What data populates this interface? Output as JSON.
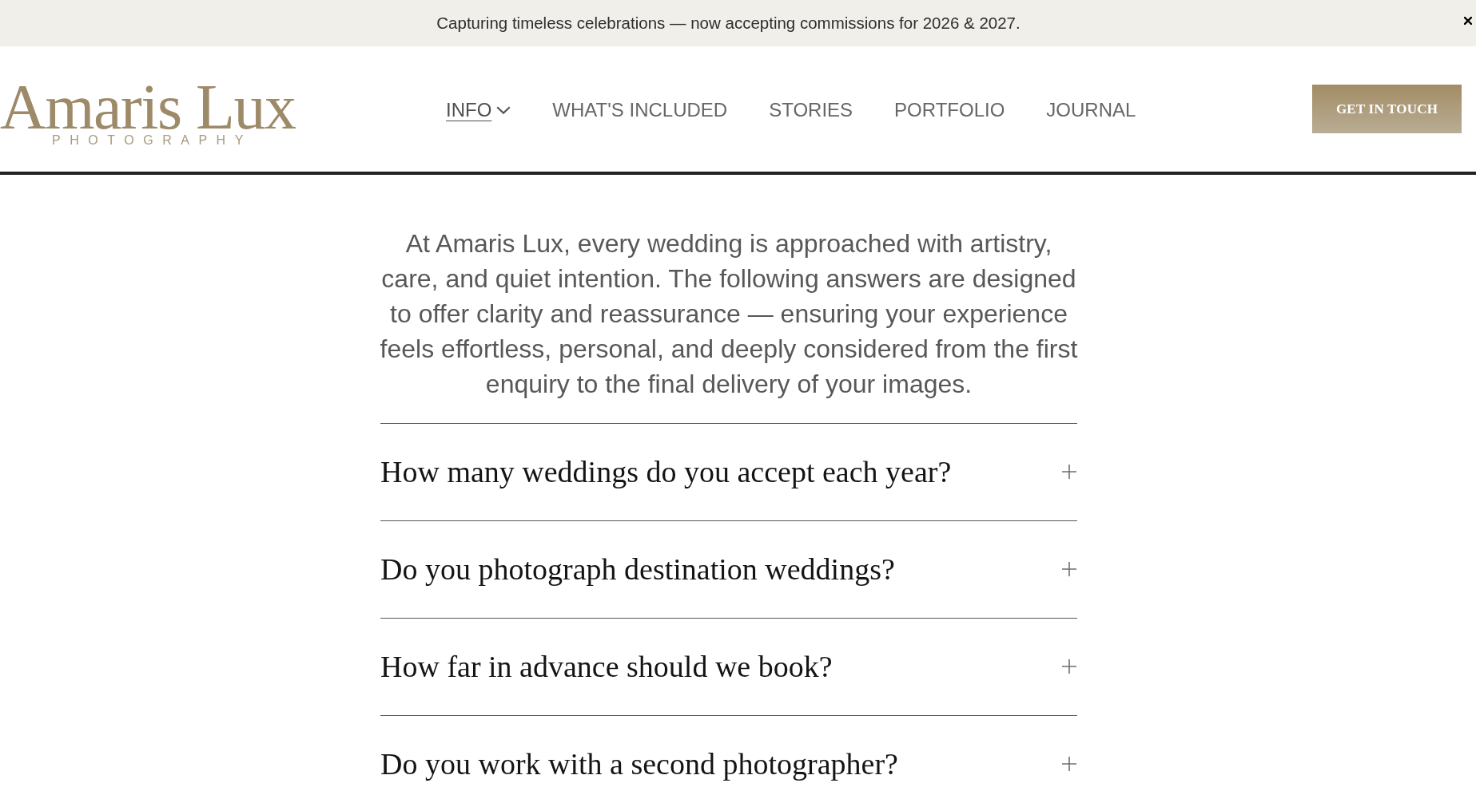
{
  "announcement": {
    "text": "Capturing timeless celebrations — now accepting commissions for 2026 & 2027."
  },
  "header": {
    "logo": {
      "name": "Amaris Lux",
      "tagline": "PHOTOGRAPHY"
    },
    "nav": [
      {
        "label": "INFO",
        "selected": true,
        "dropdown": true
      },
      {
        "label": "WHAT'S INCLUDED",
        "selected": false,
        "dropdown": false
      },
      {
        "label": "STORIES",
        "selected": false,
        "dropdown": false
      },
      {
        "label": "PORTFOLIO",
        "selected": false,
        "dropdown": false
      },
      {
        "label": "JOURNAL",
        "selected": false,
        "dropdown": false
      }
    ],
    "cta": "GET IN TOUCH"
  },
  "intro": "At Amaris Lux, every wedding is approached with artistry, care, and quiet intention. The following answers are designed to offer clarity and reassurance — ensuring your experience feels effortless, personal, and deeply considered from the first enquiry to the final delivery of your images.",
  "faq": [
    {
      "question": "How many weddings do you accept each year?",
      "expanded": false
    },
    {
      "question": "Do you photograph destination weddings?",
      "expanded": false
    },
    {
      "question": "How far in advance should we book?",
      "expanded": false
    },
    {
      "question": "Do you work with a second photographer?",
      "expanded": false
    }
  ]
}
